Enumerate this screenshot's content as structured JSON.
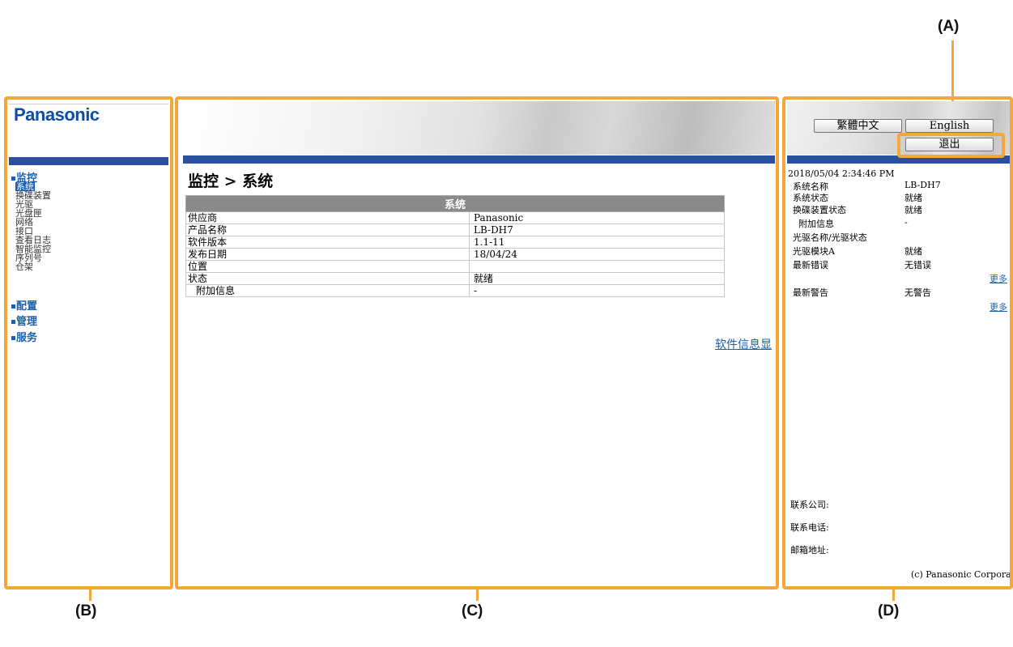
{
  "callouts": {
    "a": "(A)",
    "b": "(B)",
    "c": "(C)",
    "d": "(D)"
  },
  "brand": "Panasonic",
  "nav": {
    "monitor": "监控",
    "monitor_items": [
      "系统",
      "换碟装置",
      "光驱",
      "光盘匣",
      "网络",
      "接口",
      "查看日志",
      "智能监控",
      "序列号",
      "仓架"
    ],
    "config": "配置",
    "manage": "管理",
    "service": "服务"
  },
  "main": {
    "title": "监控 > 系统",
    "table_header": "系统",
    "rows": [
      {
        "label": "供应商",
        "value": "Panasonic"
      },
      {
        "label": "产品名称",
        "value": "LB-DH7"
      },
      {
        "label": "软件版本",
        "value": "1.1-11"
      },
      {
        "label": "发布日期",
        "value": "18/04/24"
      },
      {
        "label": "位置",
        "value": ""
      },
      {
        "label": "状态",
        "value": "就绪"
      },
      {
        "label": "附加信息",
        "value": "-"
      }
    ],
    "software_link": "软件信息显"
  },
  "right": {
    "lang_tc": "繁體中文",
    "lang_en": "English",
    "logout": "退出",
    "datetime": "2018/05/04    2:34:46 PM",
    "status": [
      {
        "label": "系统名称",
        "value": "LB-DH7"
      },
      {
        "label": "系统状态",
        "value": "就绪"
      },
      {
        "label": "换碟装置状态",
        "value": "就绪"
      },
      {
        "label": "附加信息",
        "value": "-"
      },
      {
        "label": "光驱名称/光驱状态",
        "value": ""
      },
      {
        "label": "光驱模块A",
        "value": "就绪"
      },
      {
        "label": "最新错误",
        "value": "无错误"
      }
    ],
    "more1": "更多",
    "latest_warning_label": "最新警告",
    "latest_warning_value": "无警告",
    "more2": "更多",
    "contact_company": "联系公司:",
    "contact_phone": "联系电话:",
    "contact_email": "邮箱地址:",
    "copyright": "(c) Panasonic Corporation"
  },
  "colors": {
    "frame": "#f5a83a",
    "brand": "#0a4ea8",
    "bar": "#2a4f9f",
    "link": "#1a5fb4"
  }
}
